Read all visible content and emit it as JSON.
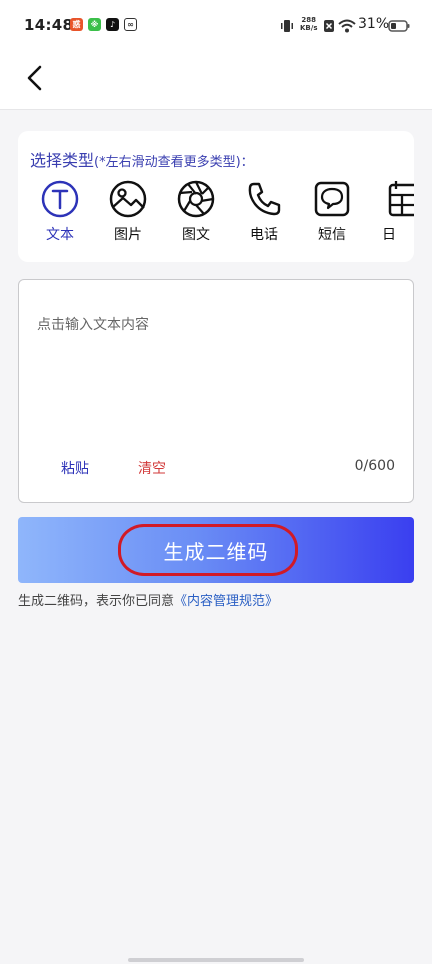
{
  "status_bar": {
    "time": "14:48",
    "net_speed_value": "288",
    "net_speed_unit": "KB/s",
    "battery": "31%"
  },
  "nav": {
    "back_icon": "chevron-left-icon"
  },
  "type_selector": {
    "title": "选择类型",
    "hint": "(*左右滑动查看更多类型)：",
    "items": [
      {
        "label": "文本",
        "icon": "text-t-icon",
        "active": true
      },
      {
        "label": "图片",
        "icon": "image-icon",
        "active": false
      },
      {
        "label": "图文",
        "icon": "aperture-icon",
        "active": false
      },
      {
        "label": "电话",
        "icon": "phone-icon",
        "active": false
      },
      {
        "label": "短信",
        "icon": "message-icon",
        "active": false
      },
      {
        "label": "日",
        "icon": "calendar-icon",
        "active": false
      }
    ]
  },
  "text_input": {
    "placeholder": "点击输入文本内容",
    "value": "",
    "paste_label": "粘贴",
    "clear_label": "清空",
    "counter": "0/600"
  },
  "generate_button": {
    "label": "生成二维码"
  },
  "agreement": {
    "text": "生成二维码，表示你已同意",
    "link": "《内容管理规范》"
  },
  "colors": {
    "accent": "#2d33b8",
    "clear": "#d23a3a",
    "gradient_start": "#8fb6fb",
    "gradient_end": "#3a3ff0",
    "annotation": "#d11a26"
  }
}
